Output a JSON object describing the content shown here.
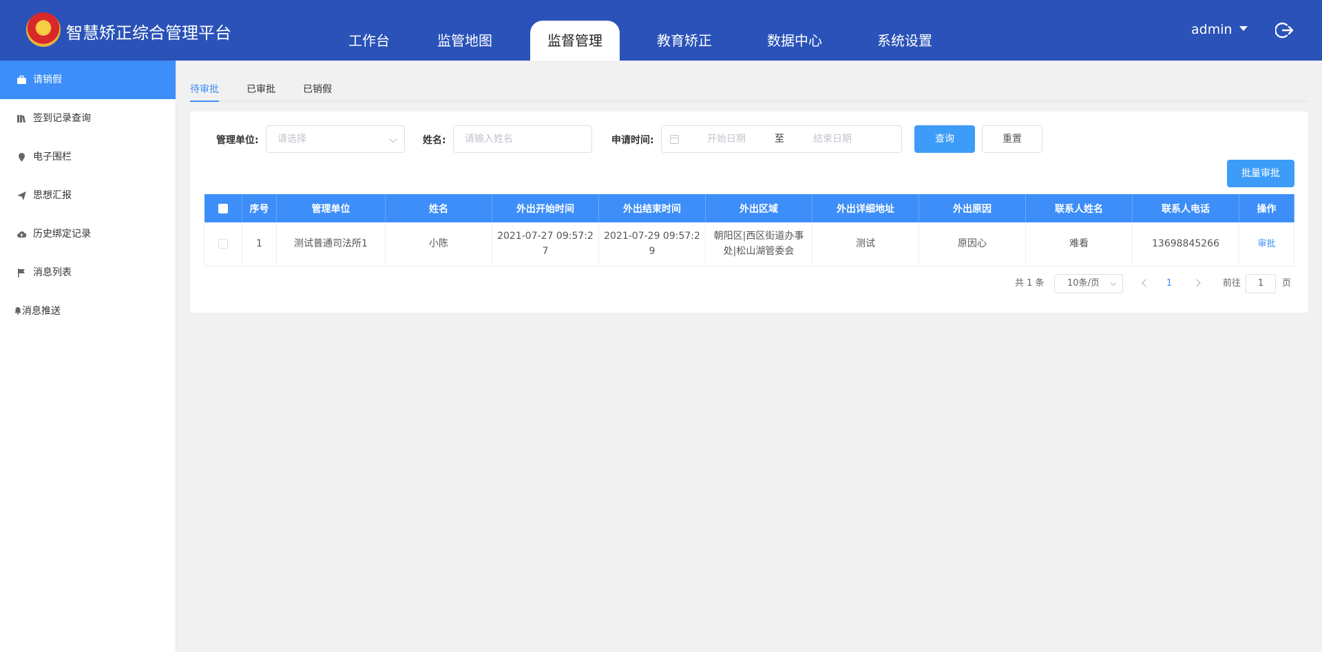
{
  "header": {
    "brand": "智慧矫正综合管理平台",
    "nav": [
      "工作台",
      "监管地图",
      "监督管理",
      "教育矫正",
      "数据中心",
      "系统设置"
    ],
    "active_nav": "监督管理",
    "user": "admin"
  },
  "sidebar": {
    "items": [
      {
        "label": "请销假",
        "icon": "briefcase-icon"
      },
      {
        "label": "签到记录查询",
        "icon": "books-icon"
      },
      {
        "label": "电子围栏",
        "icon": "location-pin-icon"
      },
      {
        "label": "思想汇报",
        "icon": "paper-plane-icon"
      },
      {
        "label": "历史绑定记录",
        "icon": "cloud-upload-icon"
      },
      {
        "label": "消息列表",
        "icon": "flag-icon"
      },
      {
        "label": "消息推送",
        "icon": "bell-icon"
      }
    ],
    "active": "请销假"
  },
  "tabs": [
    "待审批",
    "已审批",
    "已销假"
  ],
  "filters": {
    "unit_label": "管理单位:",
    "unit_placeholder": "请选择",
    "name_label": "姓名:",
    "name_placeholder": "请输入姓名",
    "time_label": "申请时间:",
    "start_placeholder": "开始日期",
    "range_sep": "至",
    "end_placeholder": "结束日期",
    "query_btn": "查询",
    "reset_btn": "重置",
    "batch_btn": "批量审批"
  },
  "table": {
    "columns": [
      "序号",
      "管理单位",
      "姓名",
      "外出开始时间",
      "外出结束时间",
      "外出区域",
      "外出详细地址",
      "外出原因",
      "联系人姓名",
      "联系人电话",
      "操作"
    ],
    "rows": [
      {
        "index": "1",
        "unit": "测试普通司法所1",
        "name": "小陈",
        "start": "2021-07-27 09:57:27",
        "end": "2021-07-29 09:57:29",
        "area": "朝阳区|西区街道办事处|松山湖管委会",
        "address": "测试",
        "reason": "原因心",
        "contact": "难看",
        "phone": "13698845266",
        "action": "审批"
      }
    ]
  },
  "pagination": {
    "total": "共 1 条",
    "page_size": "10条/页",
    "current": "1",
    "goto_prefix": "前往",
    "goto_value": "1",
    "goto_suffix": "页"
  },
  "colors": {
    "header": "#2a52b8",
    "accent": "#3d8ef8"
  }
}
